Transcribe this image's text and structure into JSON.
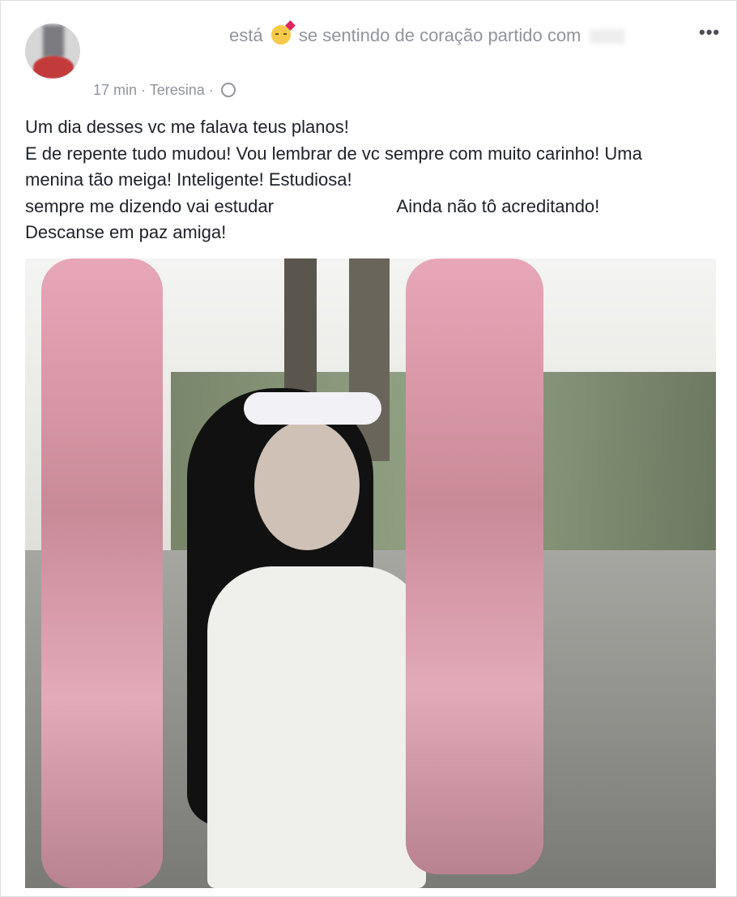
{
  "post": {
    "feeling": {
      "prefix": "está",
      "emoji": "sad-face-with-heart-icon",
      "text": "se sentindo de coração partido com"
    },
    "more_label": "•••",
    "time": "17 min",
    "separator1": "·",
    "location": "Teresina",
    "separator2": "·",
    "privacy_icon": "globe-icon",
    "text_lines": [
      "Um dia desses vc me falava teus planos!",
      "E de repente tudo mudou! Vou lembrar de vc sempre com muito carinho! Uma",
      "menina tão meiga! Inteligente! Estudiosa!",
      "sempre me dizendo vai estudar                         Ainda não tô acreditando!",
      "Descanse em paz amiga!"
    ]
  }
}
